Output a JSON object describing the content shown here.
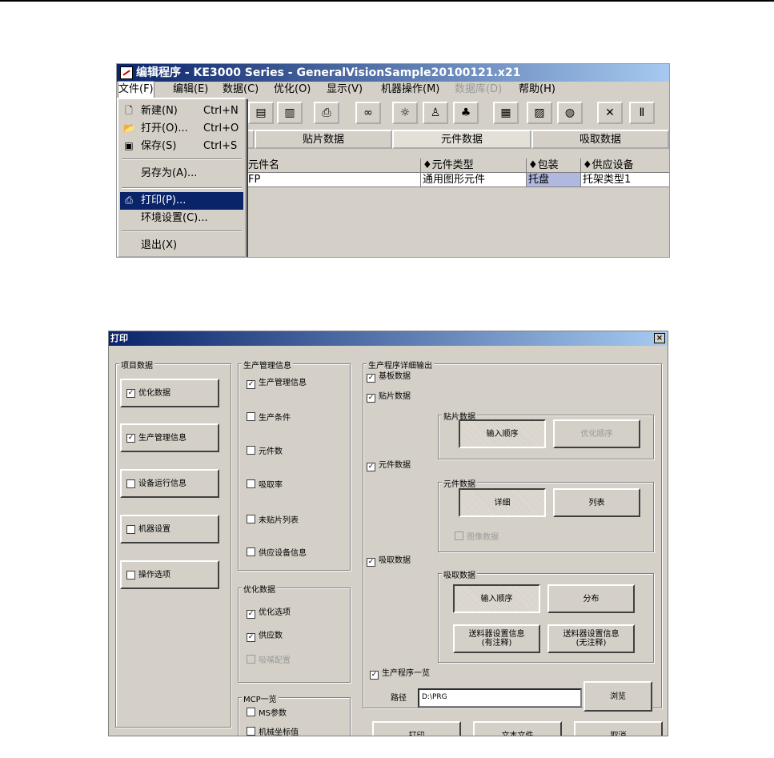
{
  "editor": {
    "title": "编辑程序 - KE3000 Series - GeneralVisionSample20100121.x21",
    "menu": [
      "文件(F)",
      "编辑(E)",
      "数据(C)",
      "优化(O)",
      "显示(V)",
      "机器操作(M)",
      "数据库(D)",
      "帮助(H)"
    ],
    "toolbar_icons": [
      "copy-icon",
      "paste-icon",
      "print-icon",
      "binoculars-icon",
      "bulb-icon",
      "feeder-icon",
      "nozzle-icon",
      "grid-icon",
      "tray-icon",
      "disk-icon",
      "x-axis-icon",
      "i-icon"
    ],
    "tabs": [
      "贴片数据",
      "元件数据",
      "吸取数据"
    ],
    "grid": {
      "headers": [
        "元件名",
        "♦元件类型",
        "♦包装",
        "♦供应设备"
      ],
      "row": [
        "FP",
        "通用图形元件",
        "托盘",
        "托架类型1"
      ]
    },
    "file_menu": [
      {
        "label": "新建(N)",
        "shortcut": "Ctrl+N",
        "icon": "new-file-icon"
      },
      {
        "label": "打开(O)...",
        "shortcut": "Ctrl+O",
        "icon": "open-folder-icon"
      },
      {
        "label": "保存(S)",
        "shortcut": "Ctrl+S",
        "icon": "save-icon"
      },
      {
        "label": "另存为(A)...",
        "shortcut": ""
      },
      {
        "label": "打印(P)...",
        "shortcut": "",
        "icon": "print-icon",
        "highlighted": true
      },
      {
        "label": "环境设置(C)...",
        "shortcut": ""
      },
      {
        "label": "退出(X)",
        "shortcut": ""
      }
    ]
  },
  "print_dialog": {
    "title": "打印",
    "groups": {
      "item_data": "项目数据",
      "production_info": "生产管理信息",
      "detail_output": "生产程序详细输出",
      "placement_data": "贴片数据",
      "component_data": "元件数据",
      "pick_data": "吸取数据",
      "optimize_data": "优化数据",
      "mcp_list": "MCP一览"
    },
    "item_buttons": [
      {
        "label": "优化数据",
        "checked": true
      },
      {
        "label": "生产管理信息",
        "checked": true
      },
      {
        "label": "设备运行信息",
        "checked": false
      },
      {
        "label": "机器设置",
        "checked": false
      },
      {
        "label": "操作选项",
        "checked": false
      }
    ],
    "production_checks": [
      {
        "label": "生产管理信息",
        "checked": true
      },
      {
        "label": "生产条件",
        "checked": false
      },
      {
        "label": "元件数",
        "checked": false
      },
      {
        "label": "吸取率",
        "checked": false
      },
      {
        "label": "未贴片列表",
        "checked": false
      },
      {
        "label": "供应设备信息",
        "checked": false
      }
    ],
    "optimize_checks": [
      {
        "label": "优化选项",
        "checked": true
      },
      {
        "label": "供应数",
        "checked": true
      },
      {
        "label": "吸嘴配置",
        "checked": false,
        "disabled": true
      }
    ],
    "mcp_checks": [
      {
        "label": "MS参数",
        "checked": false
      },
      {
        "label": "机械坐标值",
        "checked": false
      }
    ],
    "detail_checks": {
      "basic": {
        "label": "基板数据",
        "checked": true
      },
      "placement": {
        "label": "贴片数据",
        "checked": true
      },
      "component": {
        "label": "元件数据",
        "checked": true
      },
      "pick": {
        "label": "吸取数据",
        "checked": true
      },
      "program_list": {
        "label": "生产程序一览",
        "checked": true
      }
    },
    "placement_buttons": [
      "输入顺序",
      "优化顺序"
    ],
    "component_buttons": [
      "详细",
      "列表"
    ],
    "image_data": {
      "label": "图像数据",
      "checked": false
    },
    "pick_buttons": [
      "输入顺序",
      "分布",
      "送料器设置信息\n(有注释)",
      "送料器设置信息\n(无注释)"
    ],
    "path_label": "路径",
    "path_value": "D:\\PRG",
    "browse": "浏览",
    "footer_buttons": [
      "打印",
      "文本文件",
      "取消"
    ]
  }
}
